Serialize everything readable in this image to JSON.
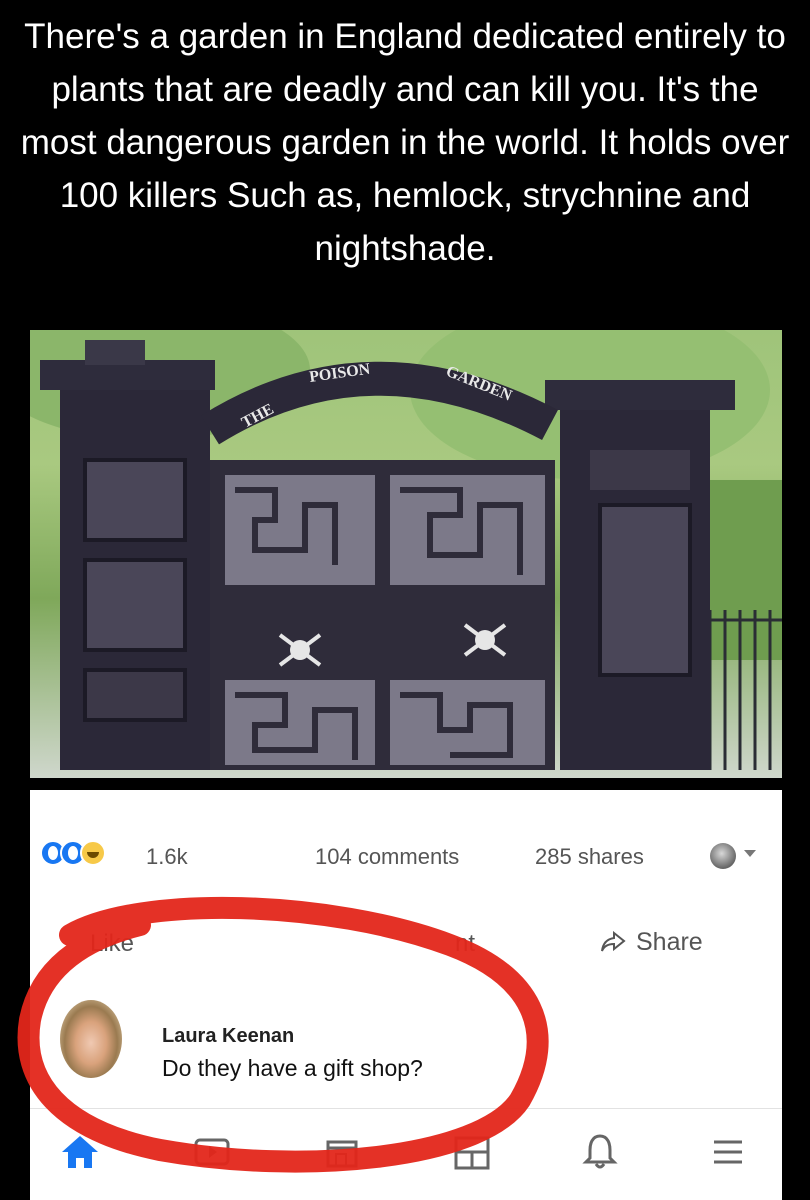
{
  "post": {
    "caption": "There's a garden in England dedicated entirely to plants that are deadly and can kill you. It's the most dangerous garden in the world. It holds over 100 killers Such as, hemlock, strychnine and nightshade."
  },
  "photo": {
    "arch_text_1": "THE",
    "arch_text_2": "POISON",
    "arch_text_3": "GARDEN"
  },
  "stats": {
    "reactions_count": "1.6k",
    "comments": "104 comments",
    "shares": "285 shares"
  },
  "actions": {
    "like": "Like",
    "comment": "nt",
    "share": "Share"
  },
  "comment": {
    "author": "Laura Keenan",
    "text": "Do they have a gift shop?"
  },
  "nav": {
    "items": [
      "home-icon",
      "video-icon",
      "marketplace-icon",
      "groups-icon",
      "bell-icon",
      "menu-icon"
    ]
  },
  "colors": {
    "accent": "#1877f2",
    "annotation": "#e3261a"
  }
}
